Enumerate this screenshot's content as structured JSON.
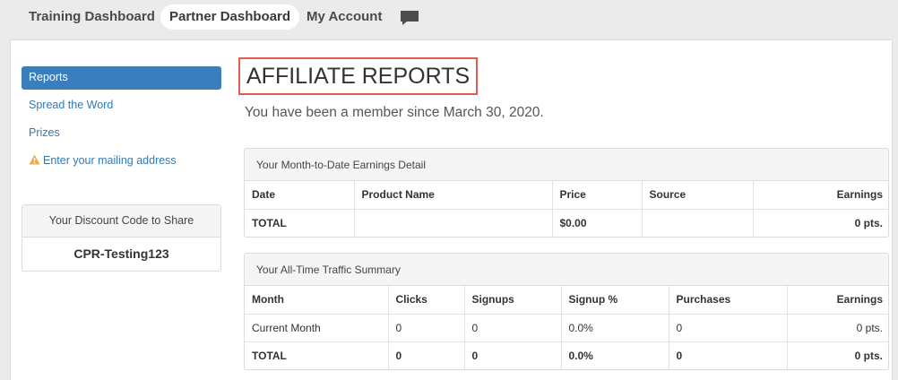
{
  "topnav": {
    "training": "Training Dashboard",
    "partner": "Partner Dashboard",
    "account": "My Account",
    "chat_icon": "chat-bubble-icon"
  },
  "sidebar": {
    "items": [
      {
        "label": "Reports",
        "active": true
      },
      {
        "label": "Spread the Word"
      },
      {
        "label": "Prizes"
      },
      {
        "label": "Enter your mailing address",
        "icon": "warning-icon"
      }
    ],
    "discount": {
      "heading": "Your Discount Code to Share",
      "code": "CPR-Testing123"
    }
  },
  "main": {
    "title": "AFFILIATE REPORTS",
    "member_since": "You have been a member since March 30, 2020."
  },
  "earnings": {
    "heading": "Your Month-to-Date Earnings Detail",
    "columns": [
      "Date",
      "Product Name",
      "Price",
      "Source",
      "Earnings"
    ],
    "total": {
      "label": "TOTAL",
      "product": "",
      "price": "$0.00",
      "source": "",
      "earnings": "0 pts."
    }
  },
  "traffic": {
    "heading": "Your All-Time Traffic Summary",
    "columns": [
      "Month",
      "Clicks",
      "Signups",
      "Signup %",
      "Purchases",
      "Earnings"
    ],
    "rows": [
      {
        "month": "Current Month",
        "clicks": "0",
        "signups": "0",
        "signup_pct": "0.0%",
        "purchases": "0",
        "earnings": "0 pts."
      }
    ],
    "total": {
      "month": "TOTAL",
      "clicks": "0",
      "signups": "0",
      "signup_pct": "0.0%",
      "purchases": "0",
      "earnings": "0 pts."
    }
  },
  "colors": {
    "accent": "#3a7ebd",
    "link": "#3379b5",
    "title_highlight": "#e45a54",
    "warning": "#f0ad4e"
  }
}
